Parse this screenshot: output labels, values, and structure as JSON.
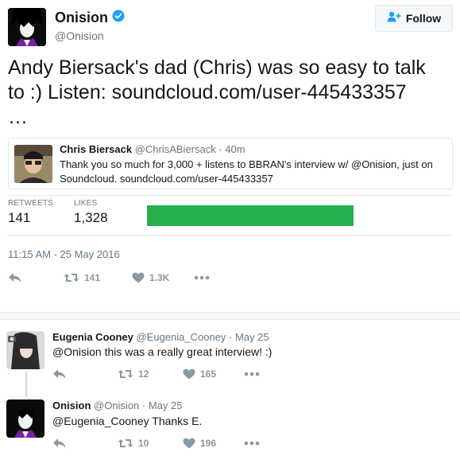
{
  "main_tweet": {
    "author_name": "Onision",
    "author_handle": "@Onision",
    "follow_label": "Follow",
    "text_line1": "Andy Biersack's dad (Chris) was so easy to talk",
    "text_line2": "to :) Listen: soundcloud.com/user-445433357",
    "text_line3": "…",
    "quote": {
      "name": "Chris Biersack",
      "handle": "@ChrisABiersack",
      "time": "· 40m",
      "text": "Thank you so much for 3,000 + listens to BBRAN's interview w/ @Onision, just on Soundcloud. soundcloud.com/user-445433357"
    },
    "stats": {
      "retweets_label": "RETWEETS",
      "retweets_value": "141",
      "likes_label": "LIKES",
      "likes_value": "1,328"
    },
    "timestamp": "11:15 AM - 25 May 2016",
    "actions": {
      "retweet_count": "141",
      "like_count": "1.3K"
    }
  },
  "replies": [
    {
      "name": "Eugenia Cooney",
      "handle": "@Eugenia_Cooney",
      "time": "· May 25",
      "text": "@Onision this was a really great interview! :)",
      "retweet_count": "12",
      "like_count": "165"
    },
    {
      "name": "Onision",
      "handle": "@Onision",
      "time": "· May 25",
      "text": "@Eugenia_Cooney Thanks E.",
      "retweet_count": "10",
      "like_count": "196"
    }
  ],
  "colors": {
    "verified": "#1da1f2",
    "green_bar": "#26b050",
    "muted": "#657786",
    "action": "#8899a6"
  },
  "icons": [
    "verified-icon",
    "follow-person-icon",
    "reply-icon",
    "retweet-icon",
    "like-icon",
    "more-icon"
  ]
}
